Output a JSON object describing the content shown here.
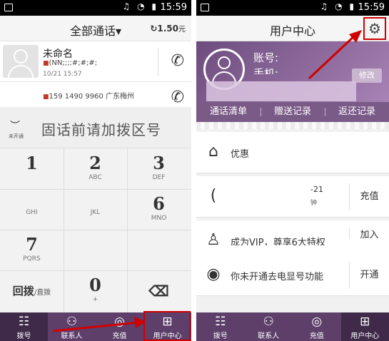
{
  "status": {
    "time": "15:59",
    "icons": "♫ ◔ ▮",
    "left": "▣"
  },
  "left": {
    "header": {
      "title": "全部通话",
      "title_caret": "▾",
      "balance": "1.50",
      "balance_unit": "元",
      "refresh_icon": "↻"
    },
    "calls": [
      {
        "name": "未命名",
        "number": "(NN;;;;#;#;#;",
        "date": "10/21 15:57",
        "tag": "■"
      },
      {
        "name": "",
        "number": "159 1490 9960 广东梅州",
        "date": "",
        "tag": "■"
      }
    ],
    "dial": {
      "eye_label": "未开通",
      "placeholder": "固话前请加拨区号"
    },
    "keys": [
      {
        "digit": "1",
        "letters": ""
      },
      {
        "digit": "2",
        "letters": "ABC"
      },
      {
        "digit": "3",
        "letters": "DEF"
      },
      {
        "digit": "",
        "letters": "GHI"
      },
      {
        "digit": "",
        "letters": "JKL"
      },
      {
        "digit": "6",
        "letters": "MNO"
      },
      {
        "digit": "7",
        "letters": "PQRS"
      },
      {
        "digit": "",
        "letters": ""
      },
      {
        "digit": "",
        "letters": ""
      },
      {
        "digit": "回拨",
        "letters": "直拨"
      },
      {
        "digit": "0",
        "letters": "+"
      },
      {
        "digit": "⌫",
        "letters": ""
      }
    ],
    "tabs": [
      {
        "label": "拨号",
        "icon": "☷"
      },
      {
        "label": "联系人",
        "icon": "⚇"
      },
      {
        "label": "充值",
        "icon": "◎"
      },
      {
        "label": "用户中心",
        "icon": "⊞"
      }
    ]
  },
  "right": {
    "header": {
      "title": "用户中心",
      "gear_icon": "⚙"
    },
    "profile": {
      "account_label": "账号:",
      "phone_label": "手机:",
      "edit": "修改"
    },
    "record_tabs": [
      "通话清单",
      "赠送记录",
      "返还记录"
    ],
    "menu": [
      {
        "icon": "⌂",
        "text": "优惠",
        "action": "",
        "sub": "",
        "sub2": ""
      },
      {
        "icon": "(",
        "text": "",
        "action": "充值",
        "sub": "-21",
        "sub2": "钟"
      },
      {
        "icon": "♙",
        "text": "成为VIP，尊享6大特权",
        "action": "加入",
        "sub": "",
        "sub2": ""
      },
      {
        "icon": "◉",
        "text": "你未开通去电显号功能",
        "action": "开通",
        "sub": "",
        "sub2": ""
      }
    ],
    "tabs": [
      {
        "label": "拨号",
        "icon": "☷"
      },
      {
        "label": "联系人",
        "icon": "⚇"
      },
      {
        "label": "充值",
        "icon": "◎"
      },
      {
        "label": "用户中心",
        "icon": "⊞"
      }
    ]
  }
}
